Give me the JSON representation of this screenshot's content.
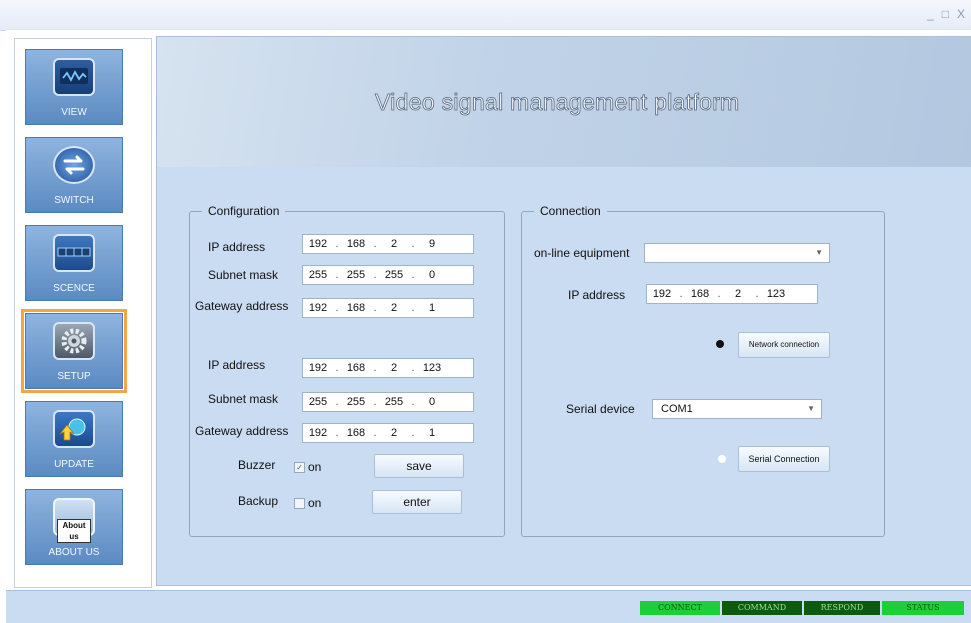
{
  "window": {
    "controls": [
      "_",
      "□",
      "X"
    ]
  },
  "sidebar": {
    "items": [
      {
        "label": "VIEW",
        "icon": "waveform-monitor-icon"
      },
      {
        "label": "SWITCH",
        "icon": "switch-arrows-icon"
      },
      {
        "label": "SCENCE",
        "icon": "scene-panel-icon"
      },
      {
        "label": "SETUP",
        "icon": "gear-icon",
        "active": true
      },
      {
        "label": "UPDATE",
        "icon": "update-icon"
      },
      {
        "label": "ABOUT US",
        "icon": "about-us-icon",
        "icon_text": "About us"
      }
    ]
  },
  "banner": {
    "title": "Video signal management platform"
  },
  "configuration": {
    "title": "Configuration",
    "ip1": {
      "label": "IP address",
      "octets": [
        "192",
        "168",
        "2",
        "9"
      ]
    },
    "mask1": {
      "label": "Subnet mask",
      "octets": [
        "255",
        "255",
        "255",
        "0"
      ]
    },
    "gw1": {
      "label": "Gateway address",
      "octets": [
        "192",
        "168",
        "2",
        "1"
      ]
    },
    "ip2": {
      "label": "IP address",
      "octets": [
        "192",
        "168",
        "2",
        "123"
      ]
    },
    "mask2": {
      "label": "Subnet mask",
      "octets": [
        "255",
        "255",
        "255",
        "0"
      ]
    },
    "gw2": {
      "label": "Gateway address",
      "octets": [
        "192",
        "168",
        "2",
        "1"
      ]
    },
    "buzzer": {
      "label": "Buzzer",
      "option": "on",
      "checked": true
    },
    "backup": {
      "label": "Backup",
      "option": "on",
      "checked": false
    },
    "save_label": "save",
    "enter_label": "enter"
  },
  "connection": {
    "title": "Connection",
    "online_label": "on-line equipment",
    "online_value": "",
    "ip": {
      "label": "IP address",
      "octets": [
        "192",
        "168",
        "2",
        "123"
      ]
    },
    "network_button": "Network connection",
    "network_selected": true,
    "serial_label": "Serial device",
    "serial_value": "COM1",
    "serial_button": "Serial Connection",
    "serial_selected": false
  },
  "status": {
    "items": [
      {
        "label": "CONNECT",
        "bg": "#1fcf3a",
        "fg": "#0a5a10"
      },
      {
        "label": "COMMAND",
        "bg": "#0e5a0e",
        "fg": "#9be39b"
      },
      {
        "label": "RESPOND",
        "bg": "#0e5a0e",
        "fg": "#9be39b"
      },
      {
        "label": "STATUS",
        "bg": "#1fcf3a",
        "fg": "#0a5a10"
      }
    ]
  },
  "colors": {
    "accent": "#f4a54a",
    "panel": "#c9dcf2"
  }
}
